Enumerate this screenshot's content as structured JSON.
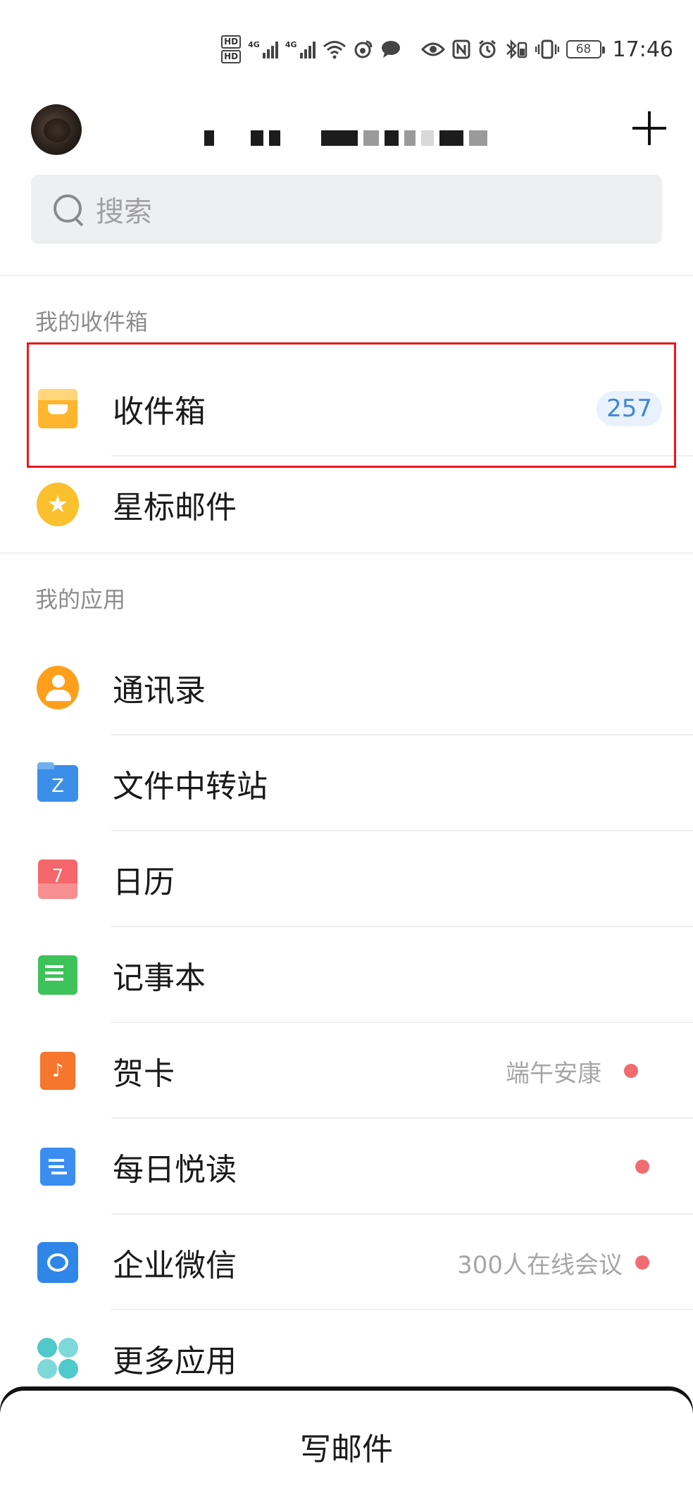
{
  "status_bar": {
    "hd1": "HD",
    "hd2": "HD",
    "net1": "4G",
    "net2": "4G",
    "battery": "68",
    "time": "17:46"
  },
  "header": {
    "search_placeholder": "搜索"
  },
  "sections": {
    "mailboxes_label": "我的收件箱",
    "apps_label": "我的应用"
  },
  "mailboxes": [
    {
      "label": "收件箱",
      "badge": "257",
      "icon": "inbox-icon"
    },
    {
      "label": "星标邮件",
      "icon": "star-icon"
    }
  ],
  "apps": [
    {
      "label": "通讯录",
      "icon": "contacts-icon"
    },
    {
      "label": "文件中转站",
      "icon": "folder-icon",
      "glyph": "Z"
    },
    {
      "label": "日历",
      "icon": "calendar-icon",
      "glyph": "7"
    },
    {
      "label": "记事本",
      "icon": "notepad-icon"
    },
    {
      "label": "贺卡",
      "icon": "greeting-card-icon",
      "glyph": "♪",
      "hint": "端午安康"
    },
    {
      "label": "每日悦读",
      "icon": "daily-reading-icon"
    },
    {
      "label": "企业微信",
      "icon": "wework-icon",
      "hint": "300人在线会议"
    },
    {
      "label": "更多应用",
      "icon": "more-apps-icon"
    }
  ],
  "compose": {
    "label": "写邮件"
  },
  "colors": {
    "accent_blue": "#3f86d6",
    "badge_bg": "#e8f1fc",
    "unread_dot": "#f26b6e",
    "highlight": "#e8191d"
  }
}
